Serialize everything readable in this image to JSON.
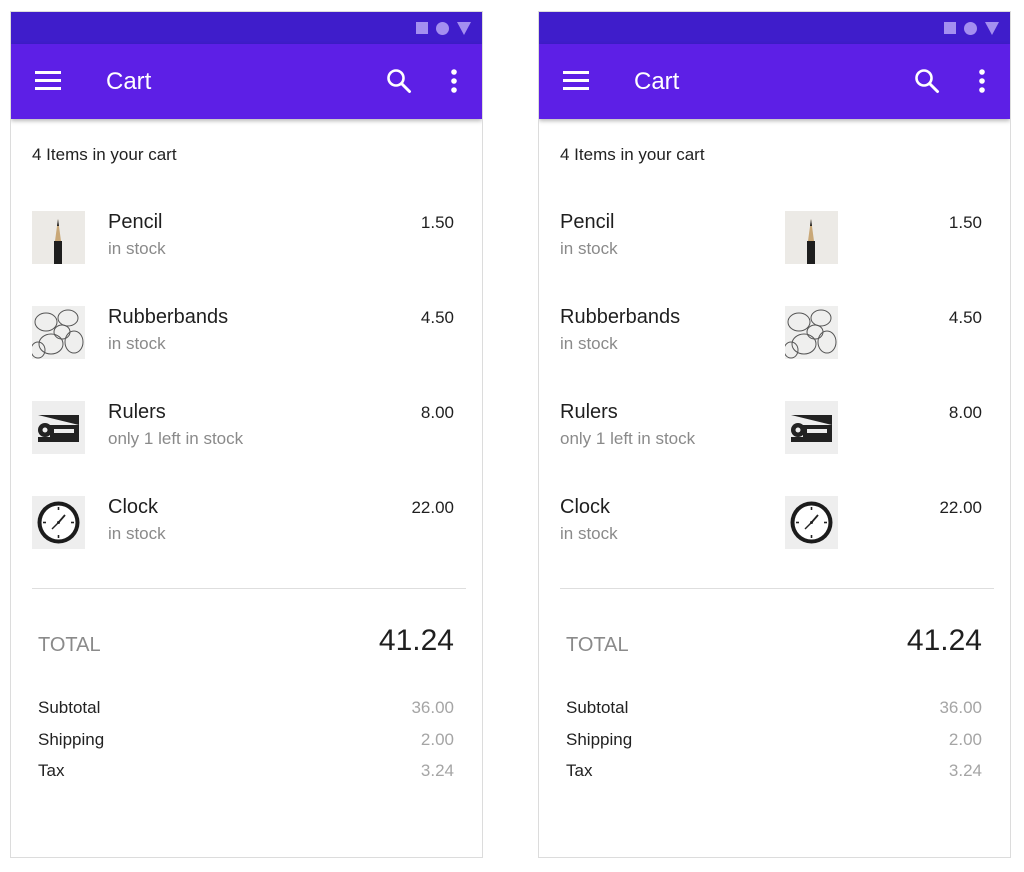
{
  "app_bar": {
    "title": "Cart",
    "color": "#5d1fe6",
    "status_bar_color": "#3f1dcb",
    "icons": [
      "menu-icon",
      "search-icon",
      "more-vert-icon"
    ]
  },
  "status_bar": {
    "icons": [
      "square-icon",
      "circle-icon",
      "triangle-icon"
    ]
  },
  "cart": {
    "count_text": "4 Items in your cart",
    "items": [
      {
        "name": "Pencil",
        "status": "in stock",
        "price": "1.50",
        "thumbnail": "pencil-image"
      },
      {
        "name": "Rubberbands",
        "status": "in stock",
        "price": "4.50",
        "thumbnail": "rubberbands-image"
      },
      {
        "name": "Rulers",
        "status": "only 1 left in stock",
        "price": "8.00",
        "thumbnail": "rulers-image"
      },
      {
        "name": "Clock",
        "status": "in stock",
        "price": "22.00",
        "thumbnail": "clock-image"
      }
    ]
  },
  "summary": {
    "total_label": "TOTAL",
    "total_value": "41.24",
    "rows": [
      {
        "label": "Subtotal",
        "value": "36.00"
      },
      {
        "label": "Shipping",
        "value": "2.00"
      },
      {
        "label": "Tax",
        "value": "3.24"
      }
    ]
  }
}
